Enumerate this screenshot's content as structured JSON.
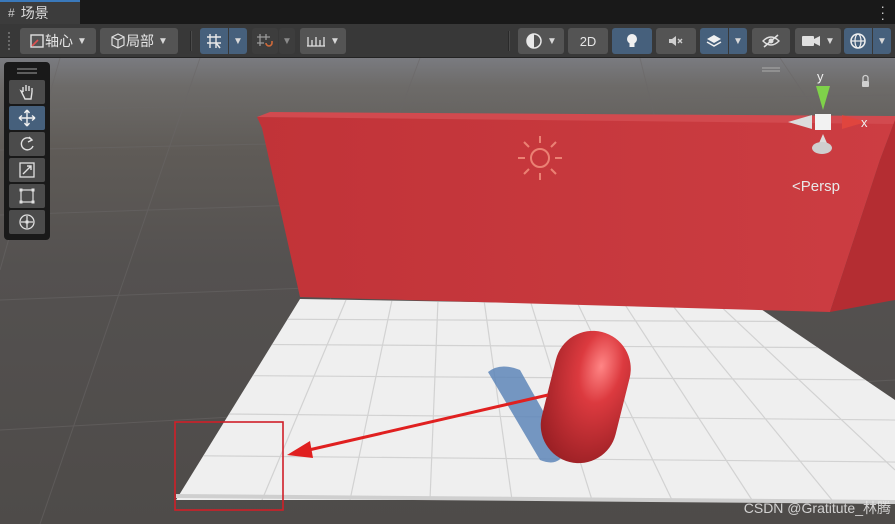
{
  "tab": {
    "icon": "grid-hash-icon",
    "title": "场景"
  },
  "toolbar": {
    "pivot_label": "轴心",
    "local_label": "局部",
    "twod_label": "2D"
  },
  "scene": {
    "persp_label": "<Persp",
    "gizmo_y": "y",
    "gizmo_x": "x"
  },
  "watermark": "CSDN @Gratitute_林腾",
  "colors": {
    "accent": "#46607c",
    "wall": "#c5383d",
    "capsule": "#d7353a",
    "arrow": "#e02020",
    "highlight_box": "#d01f28"
  }
}
